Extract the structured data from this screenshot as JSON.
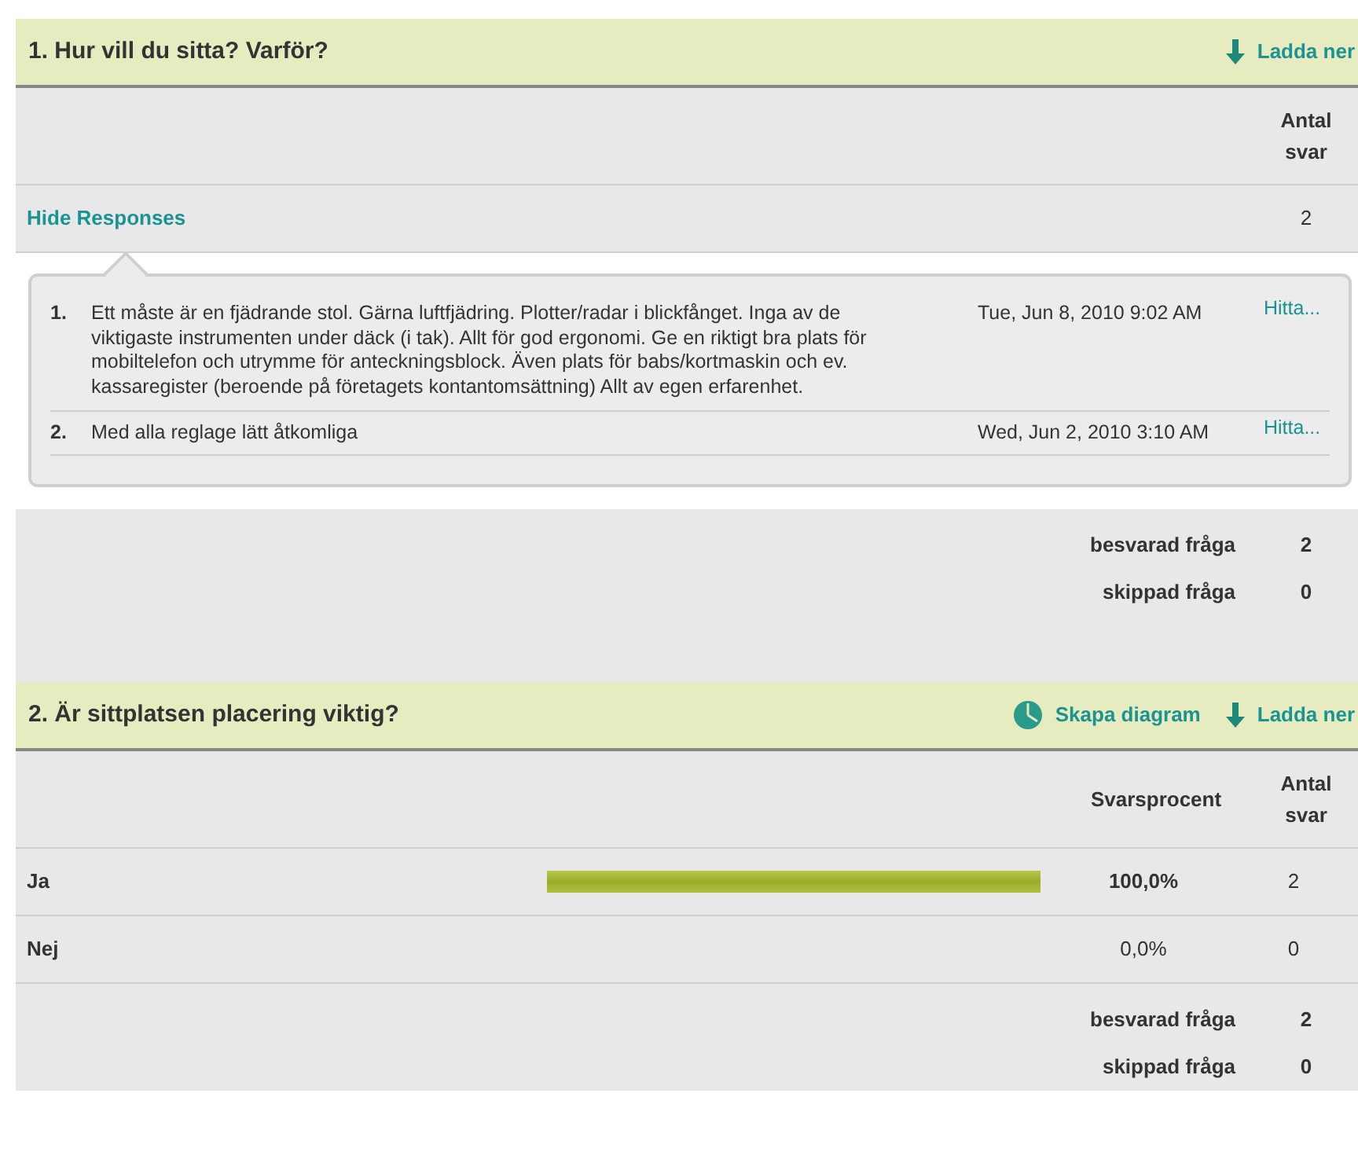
{
  "questions": [
    {
      "kind": "open_ended",
      "title": "1. Hur vill du sitta? Varför?",
      "actions": [
        {
          "kind": "download",
          "label": "Ladda ner"
        }
      ],
      "columns": {
        "count": "Antal svar"
      },
      "toggle": {
        "label": "Hide Responses",
        "count": "2"
      },
      "responses": [
        {
          "number": "1.",
          "text": "Ett måste är en fjädrande stol. Gärna luftfjädring. Plotter/radar i blickfånget. Inga av de viktigaste instrumenten under däck (i tak). Allt för god ergonomi. Ge en riktigt bra plats för mobiltelefon och utrymme för anteckningsblock. Även plats för babs/kortmaskin och ev. kassaregister (beroende på företagets kontantomsättning) Allt av egen erfarenhet.",
          "date": "Tue, Jun 8, 2010 9:02 AM",
          "link": "Hitta..."
        },
        {
          "number": "2.",
          "text": "Med alla reglage lätt åtkomliga",
          "date": "Wed, Jun 2, 2010 3:10 AM",
          "link": "Hitta..."
        }
      ],
      "summary": [
        {
          "label": "besvarad fråga",
          "value": "2"
        },
        {
          "label": "skippad fråga",
          "value": "0"
        }
      ]
    },
    {
      "kind": "choice",
      "title": "2. Är sittplatsen placering viktig?",
      "actions": [
        {
          "kind": "chart",
          "label": "Skapa diagram"
        },
        {
          "kind": "download",
          "label": "Ladda ner"
        }
      ],
      "columns": {
        "percent": "Svarsprocent",
        "count": "Antal svar"
      },
      "options": [
        {
          "label": "Ja",
          "percent": "100,0%",
          "count": "2"
        },
        {
          "label": "Nej",
          "percent": "0,0%",
          "count": "0"
        }
      ],
      "summary": [
        {
          "label": "besvarad fråga",
          "value": "2"
        },
        {
          "label": "skippad fråga",
          "value": "0"
        }
      ]
    }
  ]
}
